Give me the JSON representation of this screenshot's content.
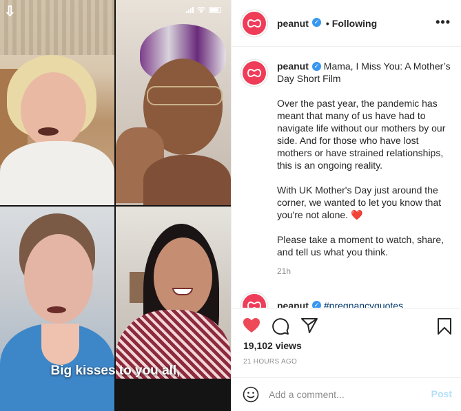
{
  "media": {
    "caption": "Big kisses to you all,",
    "status_icons": [
      "signal-icon",
      "wifi-icon",
      "battery-icon"
    ]
  },
  "header": {
    "username": "peanut",
    "separator": "•",
    "follow_state": "Following",
    "more_label": "•••"
  },
  "post": {
    "username": "peanut",
    "title": "Mama, I Miss You: A Mother’s Day Short Film",
    "paragraphs": [
      "Over the past year, the pandemic has meant that many of us have had to navigate life without our mothers by our side. And for those who have lost mothers or have strained relationships, this is an ongoing reality.",
      "With UK Mother's Day just around the corner, we wanted to let you know that you're not alone.",
      "Please take a moment to watch, share, and tell us what you think."
    ],
    "heart_emoji": "❤️",
    "time": "21h"
  },
  "next_comment": {
    "username": "peanut",
    "text": "#pregnancyquotes"
  },
  "actions": {
    "views": "19,102 views",
    "ago": "21 HOURS AGO"
  },
  "composer": {
    "placeholder": "Add a comment...",
    "post_label": "Post"
  },
  "colors": {
    "brand": "#ef3c58",
    "like": "#ed4956",
    "verified": "#3897f0",
    "link": "#00376b",
    "post_disabled": "#b2dffc"
  }
}
